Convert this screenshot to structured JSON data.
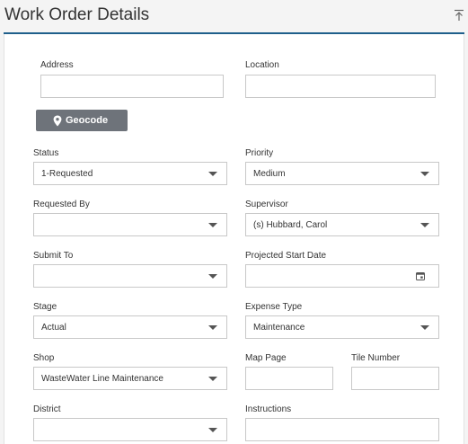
{
  "header": {
    "title": "Work Order Details"
  },
  "colors": {
    "accent": "#1f5f8b",
    "button": "#6e737a"
  },
  "icons": {
    "collapse": "collapse-up-icon",
    "geocode": "map-pin-icon",
    "calendar": "calendar-icon",
    "dropdown": "caret-down-icon"
  },
  "form": {
    "address_label": "Address",
    "address_value": "",
    "location_label": "Location",
    "location_value": "",
    "geocode_label": "Geocode",
    "status_label": "Status",
    "status_value": "1-Requested",
    "priority_label": "Priority",
    "priority_value": "Medium",
    "requested_by_label": "Requested By",
    "requested_by_value": "",
    "supervisor_label": "Supervisor",
    "supervisor_value": "(s) Hubbard, Carol",
    "submit_to_label": "Submit To",
    "submit_to_value": "",
    "projected_start_label": "Projected Start Date",
    "projected_start_value": "",
    "stage_label": "Stage",
    "stage_value": "Actual",
    "expense_type_label": "Expense Type",
    "expense_type_value": "Maintenance",
    "shop_label": "Shop",
    "shop_value": "WasteWater Line Maintenance",
    "map_page_label": "Map Page",
    "map_page_value": "",
    "tile_number_label": "Tile Number",
    "tile_number_value": "",
    "district_label": "District",
    "district_value": "",
    "instructions_label": "Instructions",
    "instructions_value": ""
  }
}
